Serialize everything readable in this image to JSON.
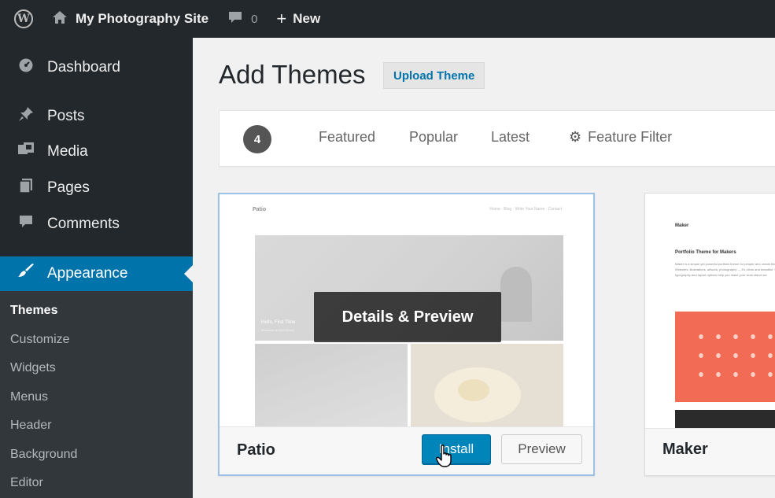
{
  "admin_bar": {
    "site_name": "My Photography Site",
    "comments_count": "0",
    "new_label": "New"
  },
  "sidebar": {
    "items": [
      {
        "label": "Dashboard",
        "icon": "dashboard-icon"
      },
      {
        "label": "Posts",
        "icon": "pin-icon"
      },
      {
        "label": "Media",
        "icon": "media-icon"
      },
      {
        "label": "Pages",
        "icon": "pages-icon"
      },
      {
        "label": "Comments",
        "icon": "comment-icon"
      },
      {
        "label": "Appearance",
        "icon": "brush-icon"
      }
    ],
    "submenu": [
      "Themes",
      "Customize",
      "Widgets",
      "Menus",
      "Header",
      "Background",
      "Editor"
    ]
  },
  "page": {
    "title": "Add Themes",
    "upload_label": "Upload Theme"
  },
  "filters": {
    "count": "4",
    "tabs": [
      "Featured",
      "Popular",
      "Latest"
    ],
    "feature_filter_label": "Feature Filter"
  },
  "themes": [
    {
      "name": "Patio",
      "overlay_label": "Details & Preview",
      "install_label": "Install",
      "preview_label": "Preview",
      "screenshot": {
        "brand": "Patio",
        "nav": "Home · Blog · Write Your Name · Contact",
        "hero_caption": "Hello, First Time",
        "hero_sub": "Welcome to WordPress"
      }
    },
    {
      "name": "Maker",
      "screenshot": {
        "brand": "Maker",
        "heading": "Portfolio Theme for Makers",
        "body": "Maker is a simple yet powerful portfolio theme for people who create things. Websites, illustrations, artwork, photography — it's clean and beautiful. Sleek typography and layout options help you make your work stand out."
      }
    }
  ],
  "colors": {
    "admin_bg": "#23282d",
    "accent": "#0073aa",
    "install_button": "#0085ba",
    "maker_coral": "#f26c55"
  }
}
